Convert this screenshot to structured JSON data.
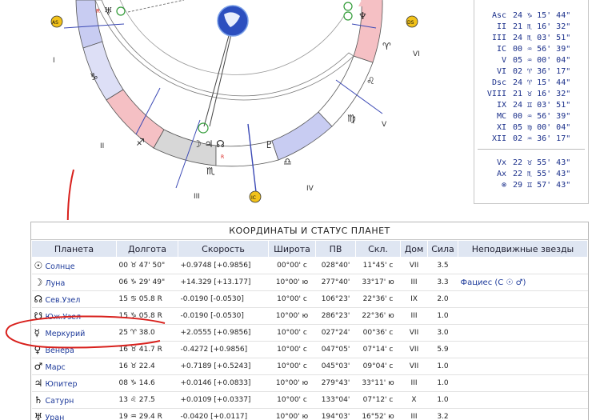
{
  "chart": {
    "house_numerals": [
      "I",
      "II",
      "III",
      "IV",
      "V",
      "VI"
    ],
    "ring_symbols": [
      "♑",
      "♐",
      "♏",
      "♎",
      "♍",
      "♌",
      "♈"
    ],
    "retro_mark": "R",
    "retro_mark_2": "R",
    "planet_cluster_left": "♅",
    "planet_cluster_bottom": "☽ ♃ ☊",
    "planet_pluto": "♇",
    "planet_right": "♆",
    "marker_labels": {
      "asc": "AS",
      "ds": "DS",
      "ic": "IC"
    }
  },
  "cusps": [
    {
      "name": "Asc",
      "value": "24 ♑ 15' 44\""
    },
    {
      "name": "II",
      "value": "21 ♏ 16' 32\""
    },
    {
      "name": "III",
      "value": "24 ♏ 03' 51\""
    },
    {
      "name": "IC",
      "value": "00 ♒ 56' 39\""
    },
    {
      "name": "V",
      "value": "05 ♒ 00' 04\""
    },
    {
      "name": "VI",
      "value": "02 ♈ 36' 17\""
    },
    {
      "name": "Dsc",
      "value": "24 ♈ 15' 44\""
    },
    {
      "name": "VIII",
      "value": "21 ♉ 16' 32\""
    },
    {
      "name": "IX",
      "value": "24 ♊ 03' 51\""
    },
    {
      "name": "MC",
      "value": "00 ♒ 56' 39\""
    },
    {
      "name": "XI",
      "value": "05 ♍ 00' 04\""
    },
    {
      "name": "XII",
      "value": "02 ♒ 36' 17\""
    }
  ],
  "extra_points": [
    {
      "name": "Vx",
      "value": "22 ♉ 55' 43\""
    },
    {
      "name": "Ax",
      "value": "22 ♏ 55' 43\""
    },
    {
      "name": "⊗",
      "value": "29 ♊ 57' 43\""
    }
  ],
  "planet_table": {
    "title": "КООРДИНАТЫ И СТАТУС ПЛАНЕТ",
    "columns": [
      "Планета",
      "Долгота",
      "Скорость",
      "Широта",
      "ПВ",
      "Скл.",
      "Дом",
      "Сила",
      "Неподвижные звезды"
    ],
    "rows": [
      {
        "glyph": "☉",
        "name": "Солнце",
        "lon": "00 ♉ 47' 50\"",
        "speed": "+0.9748  [+0.9856]",
        "lat": "00°00' с",
        "ra": "028°40'",
        "decl": "11°45' с",
        "house": "VII",
        "power": "3.5",
        "stars": ""
      },
      {
        "glyph": "☽",
        "name": "Луна",
        "lon": "06 ♑ 29' 49\"",
        "speed": "+14.329  [+13.177]",
        "lat": "10°00' ю",
        "ra": "277°40'",
        "decl": "33°17' ю",
        "house": "III",
        "power": "3.3",
        "stars": "Фациес (С ☉ ♂)"
      },
      {
        "glyph": "☊",
        "name": "Сев.Узел",
        "lon": "15 ♋ 05.8  R",
        "speed": "-0.0190  [-0.0530]",
        "lat": "10°00' с",
        "ra": "106°23'",
        "decl": "22°36' с",
        "house": "IX",
        "power": "2.0",
        "stars": ""
      },
      {
        "glyph": "☋",
        "name": "Юж.Узел",
        "lon": "15 ♑ 05.8  R",
        "speed": "-0.0190  [-0.0530]",
        "lat": "10°00' ю",
        "ra": "286°23'",
        "decl": "22°36' ю",
        "house": "III",
        "power": "1.0",
        "stars": ""
      },
      {
        "glyph": "☿",
        "name": "Меркурий",
        "lon": "25 ♈ 38.0",
        "speed": "+2.0555  [+0.9856]",
        "lat": "10°00' с",
        "ra": "027°24'",
        "decl": "00°36' с",
        "house": "VII",
        "power": "3.0",
        "stars": ""
      },
      {
        "glyph": "♀",
        "name": "Венера",
        "lon": "16 ♉ 41.7  R",
        "speed": "-0.4272  [+0.9856]",
        "lat": "10°00' с",
        "ra": "047°05'",
        "decl": "07°14' с",
        "house": "VII",
        "power": "5.9",
        "stars": ""
      },
      {
        "glyph": "♂",
        "name": "Марс",
        "lon": "16 ♉ 22.4",
        "speed": "+0.7189  [+0.5243]",
        "lat": "10°00' с",
        "ra": "045°03'",
        "decl": "09°04' с",
        "house": "VII",
        "power": "1.0",
        "stars": ""
      },
      {
        "glyph": "♃",
        "name": "Юпитер",
        "lon": "08 ♑ 14.6",
        "speed": "+0.0146  [+0.0833]",
        "lat": "10°00' ю",
        "ra": "279°43'",
        "decl": "33°11' ю",
        "house": "III",
        "power": "1.0",
        "stars": ""
      },
      {
        "glyph": "♄",
        "name": "Сатурн",
        "lon": "13 ♌ 27.5",
        "speed": "+0.0109  [+0.0337]",
        "lat": "10°00' с",
        "ra": "133°04'",
        "decl": "07°12' с",
        "house": "X",
        "power": "1.0",
        "stars": ""
      },
      {
        "glyph": "♅",
        "name": "Уран",
        "lon": "19 ♒ 29.4  R",
        "speed": "-0.0420  [+0.0117]",
        "lat": "10°00' ю",
        "ra": "194°03'",
        "decl": "16°52' ю",
        "house": "III",
        "power": "3.2",
        "stars": ""
      }
    ]
  },
  "colors": {
    "ring_blue": "#c8ccf2",
    "ring_pink": "#f5c0c4",
    "ring_gray": "#cfcfcf",
    "annotation_red": "#d8201c",
    "header_bg": "#dfe6f2",
    "link_blue": "#1d3a9a"
  }
}
